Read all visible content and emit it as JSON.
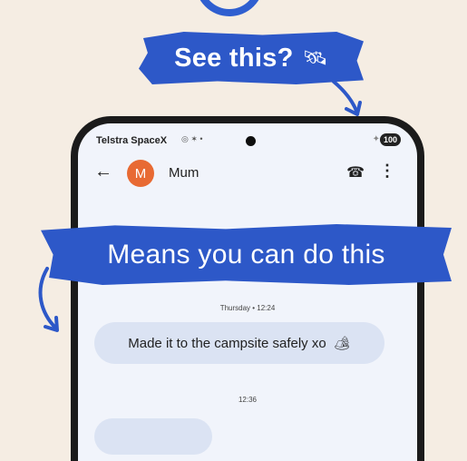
{
  "banners": {
    "top": "See this?",
    "top_icon": "satellite-icon",
    "bottom": "Means you can do this"
  },
  "status_bar": {
    "carrier": "Telstra SpaceX",
    "icons": "◎ ✶ •",
    "battery": "100"
  },
  "conversation": {
    "contact_initial": "M",
    "contact_name": "Mum",
    "avatar_color": "#e86a33",
    "timestamp_1": "Thursday • 12:24",
    "message_1": "Made it to the campsite safely xo",
    "message_1_emoji": "🏕",
    "timestamp_2": "12:36"
  },
  "colors": {
    "banner": "#2d58c8",
    "background": "#f5ede3",
    "bubble": "#dbe3f3"
  }
}
